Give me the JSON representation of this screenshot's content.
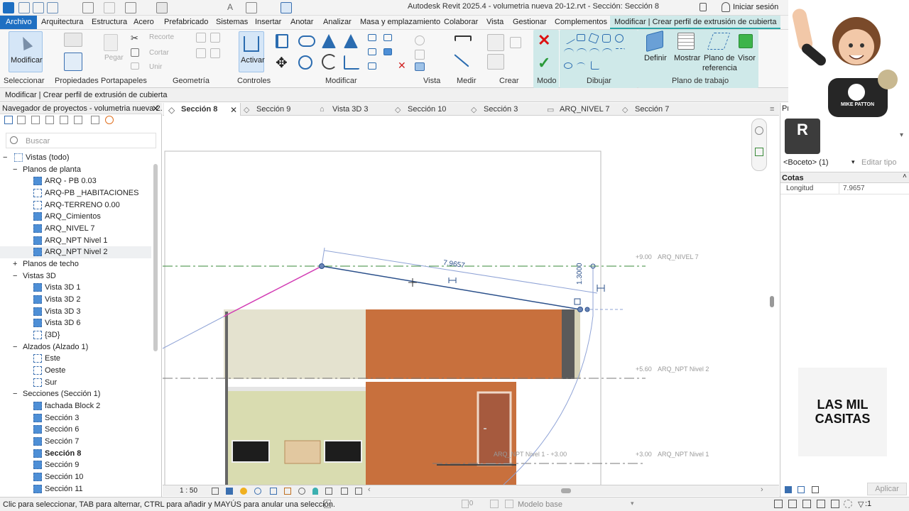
{
  "titlebar": {
    "title": "Autodesk Revit 2025.4 - volumetria nueva 20-12.rvt - Sección: Sección 8",
    "signin": "Iniciar sesión"
  },
  "menubar": {
    "items": [
      "Archivo",
      "Arquitectura",
      "Estructura",
      "Acero",
      "Prefabricado",
      "Sistemas",
      "Insertar",
      "Anotar",
      "Analizar",
      "Masa y emplazamiento",
      "Colaborar",
      "Vista",
      "Gestionar",
      "Complementos",
      "Modificar | Crear perfil de extrusión de cubierta"
    ]
  },
  "ribbon": {
    "modify_label": "Modificar",
    "paste_label": "Pegar",
    "recorte_label": "Recorte",
    "cortar_label": "Cortar",
    "unir_label": "Unir",
    "activar_label": "Activar",
    "definir_label": "Definir",
    "mostrar_label": "Mostrar",
    "plano_ref_label1": "Plano de",
    "plano_ref_label2": "referencia",
    "visor_label": "Visor",
    "panels": [
      "Seleccionar",
      "Propiedades",
      "Portapapeles",
      "Geometría",
      "Controles",
      "Modificar",
      "Vista",
      "Medir",
      "Crear",
      "Modo",
      "Dibujar",
      "Plano de trabajo"
    ]
  },
  "context_bar": "Modificar | Crear perfil de extrusión de cubierta",
  "browser": {
    "title": "Navegador de proyectos - volumetria nueva 2...",
    "search_placeholder": "Buscar",
    "root": "Vistas (todo)",
    "groups": {
      "plantas": "Planos de planta",
      "techo": "Planos de techo",
      "vistas3d": "Vistas 3D",
      "alzados": "Alzados (Alzado 1)",
      "secciones": "Secciones (Sección 1)"
    },
    "plantas": [
      "ARQ - PB 0.03",
      "ARQ-PB _HABITACIONES",
      "ARQ-TERRENO 0.00",
      "ARQ_Cimientos",
      "ARQ_NIVEL 7",
      "ARQ_NPT Nivel 1",
      "ARQ_NPT Nivel 2"
    ],
    "vistas3d": [
      "Vista 3D 1",
      "Vista 3D 2",
      "Vista 3D 3",
      "Vista 3D 6",
      "{3D}"
    ],
    "alzados": [
      "Este",
      "Oeste",
      "Sur"
    ],
    "secciones": [
      "fachada Block 2",
      "Sección 3",
      "Sección 6",
      "Sección 7",
      "Sección 8",
      "Sección 9",
      "Sección 10",
      "Sección 11"
    ]
  },
  "tabs": [
    "Sección 8",
    "Sección 9",
    "Vista 3D 3",
    "Sección 10",
    "Sección 3",
    "ARQ_NIVEL 7",
    "Sección 7"
  ],
  "canvas": {
    "dim_length": "7.9657",
    "dim_height": "1.3000",
    "levels": [
      {
        "elev": "+9.00",
        "name": "ARQ_NIVEL 7"
      },
      {
        "elev": "+5.60",
        "name": "ARQ_NPT Nivel 2"
      },
      {
        "elev": "+3.00",
        "name": "ARQ_NPT Nivel 1"
      }
    ],
    "level_left": "ARQ_NPT Nivel 1 - +3.00"
  },
  "viewbar": {
    "scale": "1 : 50"
  },
  "properties": {
    "header": "Pro",
    "type_selector": "<Boceto> (1)",
    "edit_type": "Editar tipo",
    "section": "Cotas",
    "rows": [
      {
        "label": "Longitud",
        "value": "7.9657"
      }
    ],
    "apply": "Aplicar"
  },
  "statusbar": {
    "hint": "Clic para seleccionar, TAB para alternar, CTRL para añadir y MAYÚS para anular una selección.",
    "zero": ":0",
    "model": "Modelo base",
    "filter": ":1"
  },
  "brand": {
    "line1": "LAS MIL",
    "line2": "CASITAS"
  },
  "avatar_shirt": "MIKE PATTON",
  "colors": {
    "accent": "#1e6fc2",
    "context_tab": "#cfe9e9",
    "wall_orange": "#c8703d",
    "sketch_magenta": "#d23cb4"
  }
}
